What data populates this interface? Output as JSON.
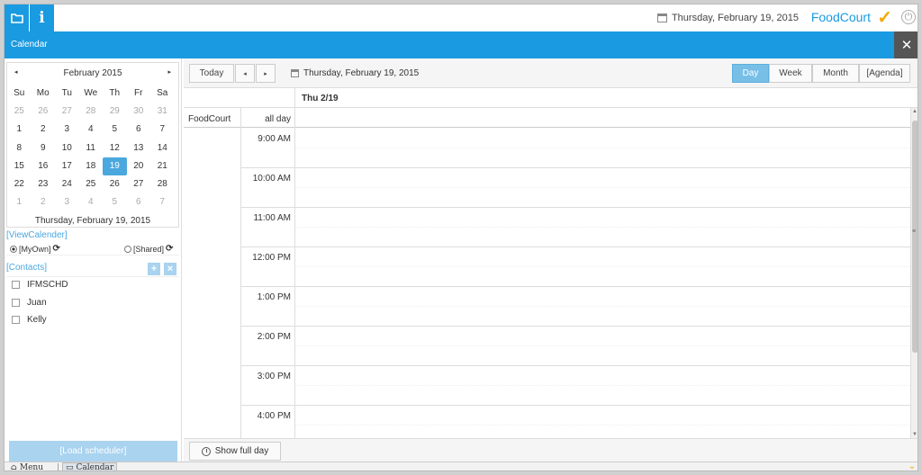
{
  "topbar": {
    "folder_icon": "folder-icon",
    "info_glyph": "i",
    "date": "Thursday, February 19, 2015",
    "brand": "FoodCourt",
    "check_icon": "check-icon",
    "power_icon": "power-icon"
  },
  "titlebar": {
    "title": "Calendar",
    "close_glyph": "✕"
  },
  "mini_calendar": {
    "month_label": "February 2015",
    "prev_glyph": "◂",
    "next_glyph": "▸",
    "weekdays": [
      "Su",
      "Mo",
      "Tu",
      "We",
      "Th",
      "Fr",
      "Sa"
    ],
    "weeks": [
      [
        "25",
        "26",
        "27",
        "28",
        "29",
        "30",
        "31"
      ],
      [
        "1",
        "2",
        "3",
        "4",
        "5",
        "6",
        "7"
      ],
      [
        "8",
        "9",
        "10",
        "11",
        "12",
        "13",
        "14"
      ],
      [
        "15",
        "16",
        "17",
        "18",
        "19",
        "20",
        "21"
      ],
      [
        "22",
        "23",
        "24",
        "25",
        "26",
        "27",
        "28"
      ],
      [
        "1",
        "2",
        "3",
        "4",
        "5",
        "6",
        "7"
      ]
    ],
    "other_month_rows": [
      0,
      5
    ],
    "selected": {
      "row": 3,
      "col": 4
    },
    "footer": "Thursday, February 19, 2015"
  },
  "view_calendar": {
    "link": "[ViewCalender]",
    "options": [
      {
        "label": "[MyOwn]",
        "checked": true
      },
      {
        "label": "[Shared]",
        "checked": false
      }
    ],
    "sync_glyph": "⟳"
  },
  "contacts": {
    "link": "[Contacts]",
    "add_glyph": "+",
    "remove_glyph": "×",
    "items": [
      {
        "label": "IFMSCHD",
        "checked": false
      },
      {
        "label": "Juan",
        "checked": false
      },
      {
        "label": "Kelly",
        "checked": false
      }
    ]
  },
  "load_button": "[Load scheduler]",
  "scheduler": {
    "today": "Today",
    "prev_glyph": "◂",
    "next_glyph": "▸",
    "date": "Thursday, February 19, 2015",
    "views": [
      "Day",
      "Week",
      "Month",
      "[Agenda]"
    ],
    "active_view": "Day",
    "day_header": "Thu 2/19",
    "resource": "FoodCourt",
    "all_day": "all day",
    "time_slots": [
      "9:00 AM",
      "10:00 AM",
      "11:00 AM",
      "12:00 PM",
      "1:00 PM",
      "2:00 PM",
      "3:00 PM",
      "4:00 PM"
    ],
    "show_full_day": "Show full day"
  },
  "taskbar": {
    "menu": "Menu",
    "calendar": "Calendar",
    "home_icon": "home-icon",
    "window_icon": "window-icon"
  },
  "colors": {
    "accent": "#1a9ae0",
    "selected_day": "#4aa8de",
    "brand_check": "#f2a800"
  }
}
